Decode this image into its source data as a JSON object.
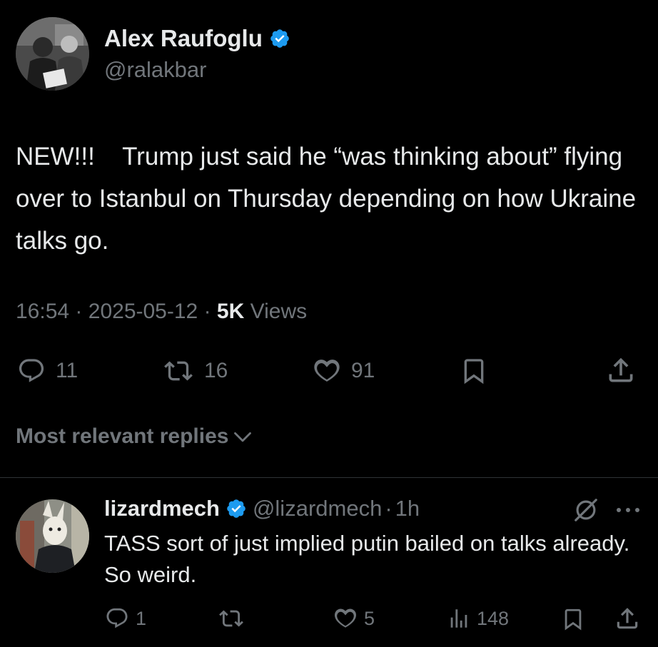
{
  "post": {
    "author": {
      "name": "Alex Raufoglu",
      "handle": "@ralakbar",
      "verified": true
    },
    "text": "NEW!!!    Trump just said he “was thinking about” flying over to Istanbul on Thursday depending on how Ukraine talks go.",
    "time": "16:54",
    "date": "2025-05-12",
    "views_count": "5K",
    "views_label": "Views",
    "separator": "·",
    "actions": {
      "replies": "11",
      "reposts": "16",
      "likes": "91"
    }
  },
  "replies_section": {
    "sort_label": "Most relevant replies"
  },
  "reply": {
    "name": "lizardmech",
    "handle": "@lizardmech",
    "separator": "·",
    "time": "1h",
    "text": "TASS sort of just implied putin bailed on talks already. So weird.",
    "actions": {
      "replies": "1",
      "likes": "5",
      "views": "148"
    }
  },
  "icons": {
    "verified": "verified-badge-icon",
    "reply": "speech-bubble-icon",
    "repost": "repost-arrows-icon",
    "like": "heart-icon",
    "bookmark": "bookmark-icon",
    "share": "share-upload-icon",
    "views": "bar-chart-icon",
    "grok": "grok-slash-circle-icon",
    "more": "more-dots-icon",
    "chevron": "chevron-down-icon"
  },
  "colors": {
    "background": "#000000",
    "text_primary": "#e7e9ea",
    "text_secondary": "#71767b",
    "verified_blue": "#1d9bf0",
    "divider": "#2f3336"
  }
}
